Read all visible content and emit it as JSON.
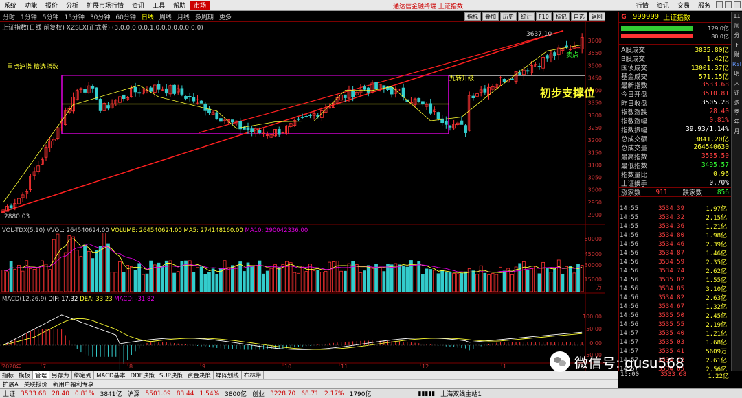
{
  "menu": {
    "items": [
      "系统",
      "功能",
      "报价",
      "分析",
      "扩展市场行情",
      "资讯",
      "工具",
      "帮助"
    ],
    "active_item": "市场",
    "app_title": "通达信金融终端 上证指数",
    "right_items": [
      "行情",
      "资讯",
      "交易",
      "服务"
    ]
  },
  "periods": {
    "items": [
      "分时",
      "1分钟",
      "5分钟",
      "15分钟",
      "30分钟",
      "60分钟",
      "日线",
      "周线",
      "月线",
      "多周期",
      "更多"
    ],
    "selected": "日线",
    "toolbar": [
      "指标",
      "叠加",
      "历史",
      "统计",
      "F10",
      "标记",
      "自选",
      "返回"
    ]
  },
  "chart": {
    "header": "上证指数(日线 前复权) XZSLX(正式版) (3,0,0,0,0,0,1,0,0,0,0,0,0,0,0)",
    "annotation_left": "重点沪指 精选指数",
    "annotation_support": "初步支撑位",
    "annotation_high": "3637.10",
    "annotation_low": "2880.03",
    "annotation_nine": "九转升级",
    "annotation_sell": "卖点",
    "x_labels": [
      "2020年",
      "7",
      "8",
      "9",
      "10",
      "11",
      "12",
      "1"
    ],
    "price_axis": [
      "3600",
      "3550",
      "3500",
      "3450",
      "3400",
      "3350",
      "3300",
      "3250",
      "3200",
      "3150",
      "3100",
      "3050",
      "3000",
      "2950",
      "2900"
    ],
    "vol_axis": [
      "60000",
      "45000",
      "30000",
      "15000",
      "万"
    ],
    "macd_axis": [
      "100.00",
      "50.00",
      "0.00",
      "-50.00"
    ]
  },
  "vol_header": {
    "name": "VOL-TDX(5,10)",
    "vvol": "VVOL: 264540624.00",
    "volume": "VOLUME: 264540624.00",
    "ma5": "MA5: 274148160.00",
    "ma10": "MA10: 290042336.00"
  },
  "macd_header": {
    "name": "MACD(12,26,9)",
    "dif": "DIF: 17.32",
    "dea": "DEA: 33.23",
    "macd": "MACD: -31.82"
  },
  "quote": {
    "code": "999999",
    "name": "上证指数",
    "bar_top": "129.0亿",
    "bar_bottom": "80.0亿",
    "rows": [
      {
        "label": "A股成交",
        "value": "3835.80亿",
        "color": "yellow"
      },
      {
        "label": "B股成交",
        "value": "1.42亿",
        "color": "yellow"
      },
      {
        "label": "国债成交",
        "value": "13001.37亿",
        "color": "yellow"
      },
      {
        "label": "基金成交",
        "value": "571.15亿",
        "color": "yellow"
      },
      {
        "label": "最新指数",
        "value": "3533.68",
        "color": "red"
      },
      {
        "label": "今日开盘",
        "value": "3510.81",
        "color": "red"
      },
      {
        "label": "昨日收盘",
        "value": "3505.28",
        "color": "white"
      },
      {
        "label": "指数涨跌",
        "value": "28.40",
        "color": "red"
      },
      {
        "label": "指数涨幅",
        "value": "0.81%",
        "color": "red"
      },
      {
        "label": "指数振幅",
        "value": "39.93/1.14%",
        "color": "white"
      },
      {
        "label": "总成交额",
        "value": "3841.20亿",
        "color": "yellow"
      },
      {
        "label": "总成交量",
        "value": "264540630",
        "color": "yellow"
      },
      {
        "label": "最高指数",
        "value": "3535.50",
        "color": "red"
      },
      {
        "label": "最低指数",
        "value": "3495.57",
        "color": "green"
      },
      {
        "label": "指数量比",
        "value": "0.96",
        "color": "yellow"
      },
      {
        "label": "上证换手",
        "value": "0.70%",
        "color": "white"
      }
    ],
    "up_label": "涨家数",
    "up_count": "911",
    "down_label": "跌家数",
    "down_count": "856"
  },
  "ticks": [
    {
      "t": "14:55",
      "p": "3534.39",
      "v": "1.97亿"
    },
    {
      "t": "14:55",
      "p": "3534.32",
      "v": "2.15亿"
    },
    {
      "t": "14:55",
      "p": "3534.36",
      "v": "1.21亿"
    },
    {
      "t": "14:56",
      "p": "3534.80",
      "v": "1.98亿"
    },
    {
      "t": "14:56",
      "p": "3534.46",
      "v": "2.39亿"
    },
    {
      "t": "14:56",
      "p": "3534.87",
      "v": "1.46亿"
    },
    {
      "t": "14:56",
      "p": "3534.59",
      "v": "2.35亿"
    },
    {
      "t": "14:56",
      "p": "3534.74",
      "v": "2.62亿"
    },
    {
      "t": "14:56",
      "p": "3535.02",
      "v": "1.55亿"
    },
    {
      "t": "14:56",
      "p": "3534.85",
      "v": "3.10亿"
    },
    {
      "t": "14:56",
      "p": "3534.82",
      "v": "2.63亿"
    },
    {
      "t": "14:56",
      "p": "3534.67",
      "v": "1.32亿"
    },
    {
      "t": "14:56",
      "p": "3535.50",
      "v": "2.45亿"
    },
    {
      "t": "14:56",
      "p": "3535.55",
      "v": "2.19亿"
    },
    {
      "t": "14:57",
      "p": "3535.40",
      "v": "1.21亿"
    },
    {
      "t": "14:57",
      "p": "3535.03",
      "v": "1.68亿"
    },
    {
      "t": "14:57",
      "p": "3535.41",
      "v": "5609万"
    },
    {
      "t": "14:57",
      "p": "3534.12",
      "v": "2.61亿"
    },
    {
      "t": "14:57",
      "p": "3534.65",
      "v": "2.56亿"
    }
  ],
  "last_tick": {
    "t": "15:00",
    "p": "3533.68",
    "v": "1.22亿"
  },
  "sidestrip": [
    "11",
    "周",
    "分",
    "F",
    "财",
    "RSI",
    "明",
    "人",
    "评",
    "多",
    "季",
    "年",
    "月"
  ],
  "bottom_tabs": [
    "指标",
    "模板",
    "管理",
    "另存为",
    "绑定到",
    "MACD基本",
    "DDE决策",
    "SUP决策",
    "资金决策",
    "蝶阵划线",
    "布林带"
  ],
  "bottom_tabs_selected": "管理",
  "bottom_bar2": [
    "扩展A",
    "关联报价",
    "新用户福利专享"
  ],
  "status": {
    "sh_label": "上证",
    "sh_price": "3533.68",
    "sh_chg": "28.40",
    "sh_pct": "0.81%",
    "sh_amt": "3841亿",
    "sz_label": "沪深",
    "sz_price": "5501.09",
    "sz_chg": "83.44",
    "sz_pct": "1.54%",
    "sz_amt": "3800亿",
    "cy_label": "创业",
    "cy_price": "3228.70",
    "cy_chg": "68.71",
    "cy_pct": "2.17%",
    "cy_amt": "1790亿",
    "server": "上海双线主站1"
  },
  "watermark": "微信号: gusu568",
  "colors": {
    "up": "#ff3333",
    "down": "#33cccc",
    "ma": "#ffff33",
    "trend": "#ff2020",
    "box": "#e000e0",
    "ma10": "#e000e0"
  }
}
